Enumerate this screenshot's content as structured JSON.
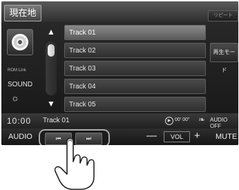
{
  "header": {
    "current_position_label": "現在地",
    "repeat_label": "リピート"
  },
  "sidebar": {
    "disc_icon": "cd-disc-icon",
    "rds_label": "ROM Link",
    "sound_label": "SOUND",
    "brightness_icon_char": "☼"
  },
  "scroll": {
    "up_char": "▲",
    "down_char": "▼"
  },
  "tracks": [
    {
      "label": "Track 01",
      "selected": true
    },
    {
      "label": "Track 02",
      "selected": false
    },
    {
      "label": "Track 03",
      "selected": false
    },
    {
      "label": "Track 04",
      "selected": false
    },
    {
      "label": "Track 05",
      "selected": false
    }
  ],
  "play_mode_label": "再生モード",
  "status": {
    "clock": "10:00",
    "now_playing": "Track 01",
    "play_icon_char": "▶",
    "elapsed": "00' 00\"",
    "audio_off_label": "AUDIO OFF"
  },
  "controls": {
    "audio_label": "AUDIO",
    "seek_back_char": "⏮",
    "seek_forward_char": "⏭",
    "vol_minus": "—",
    "vol_label": "VOL",
    "vol_plus": "+",
    "mute_label": "MUTE"
  },
  "colors": {
    "screen_bg": "#1e1e1e",
    "selected_track": "#7a7a7a",
    "highlight_outline": "#a9a9a9"
  }
}
